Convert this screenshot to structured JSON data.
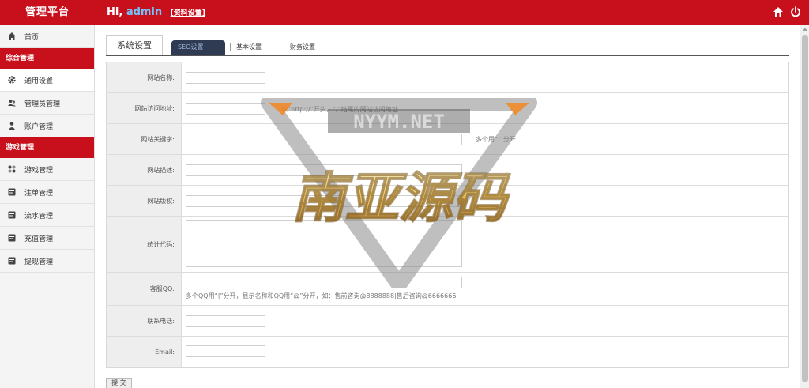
{
  "header": {
    "brand": "管理平台",
    "greeting": "Hi,",
    "username": "admin",
    "profile_link": "[资料设置]",
    "home_icon": "home-icon",
    "power_icon": "power-icon"
  },
  "sidebar": {
    "home": "首页",
    "group1": "综合管理",
    "group1_items": [
      "通用设置",
      "管理员管理",
      "账户管理"
    ],
    "group2": "游戏管理",
    "group2_items": [
      "游戏管理",
      "注单管理",
      "流水管理",
      "充值管理",
      "提现管理"
    ]
  },
  "tabs": {
    "title": "系统设置",
    "seo": "SEO设置",
    "basic": "基本设置",
    "finance": "财务设置"
  },
  "form": {
    "site_name": "网站名称:",
    "site_url": "网站访问地址:",
    "site_url_hint": "以“http://”开头，“/”结尾的网站访问地址",
    "keywords": "网站关键字:",
    "keywords_hint": "多个用“,”分开",
    "description": "网站描述:",
    "copyright": "网站版权:",
    "stats_code": "统计代码:",
    "qq": "客服QQ:",
    "qq_hint": "多个QQ用“|”分开，显示名称和QQ用“@”分开，如：售前咨询@8888888|售后咨询@6666666",
    "phone": "联系电话:",
    "email": "Email:"
  },
  "submit_label": "提 交",
  "watermark": {
    "site": "NYYM.NET",
    "name": "南亚源码"
  },
  "colors": {
    "brand_red": "#c8101d",
    "tab_active": "#2e3b53"
  }
}
